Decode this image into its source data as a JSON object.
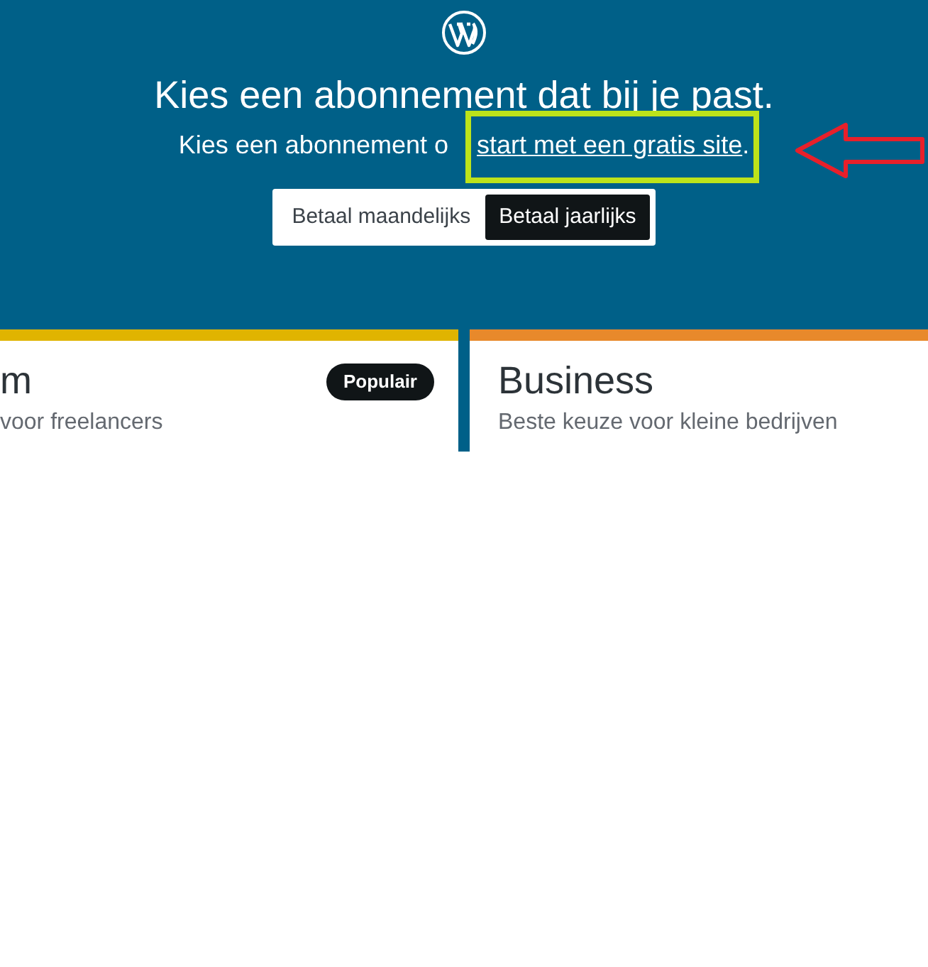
{
  "header": {
    "title": "Kies een abonnement dat bij je past.",
    "subtitle": "Kies een abonnement o",
    "link": "start met een gratis site",
    "link_suffix": ".",
    "highlighted": true
  },
  "billing_toggle": [
    {
      "label": "Betaal maandelijks",
      "selected": false
    },
    {
      "label": "Betaal jaarlijks",
      "selected": true
    }
  ],
  "plans": [
    {
      "name": "m",
      "description": "voor freelancers",
      "badge": "Populair",
      "color": "#e0b400"
    },
    {
      "name": "Business",
      "description": "Beste keuze voor kleine bedrijven",
      "color": "#e8892b"
    }
  ]
}
